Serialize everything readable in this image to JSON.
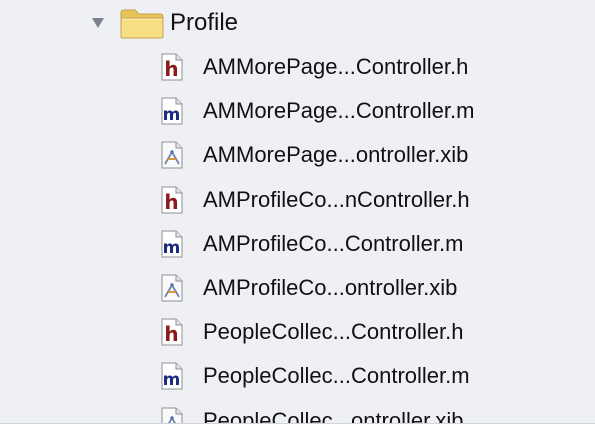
{
  "navigator": {
    "group": {
      "name": "Profile",
      "icon": "folder-icon",
      "expanded": true
    },
    "files": [
      {
        "name": "AMMorePage...Controller.h",
        "type": "h"
      },
      {
        "name": "AMMorePage...Controller.m",
        "type": "m"
      },
      {
        "name": "AMMorePage...ontroller.xib",
        "type": "xib"
      },
      {
        "name": "AMProfileCo...nController.h",
        "type": "h"
      },
      {
        "name": "AMProfileCo...Controller.m",
        "type": "m"
      },
      {
        "name": "AMProfileCo...ontroller.xib",
        "type": "xib"
      },
      {
        "name": "PeopleCollec...Controller.h",
        "type": "h"
      },
      {
        "name": "PeopleCollec...Controller.m",
        "type": "m"
      },
      {
        "name": "PeopleCollec...ontroller.xib",
        "type": "xib"
      }
    ]
  },
  "colors": {
    "background": "#eef0f4",
    "folder": "#f4d873",
    "header_letter": "#8b1a1a",
    "impl_letter": "#1c2b7d"
  },
  "icons": {
    "h": "header-file-icon",
    "m": "implementation-file-icon",
    "xib": "xib-file-icon",
    "disclosure": "disclosure-triangle-icon"
  }
}
